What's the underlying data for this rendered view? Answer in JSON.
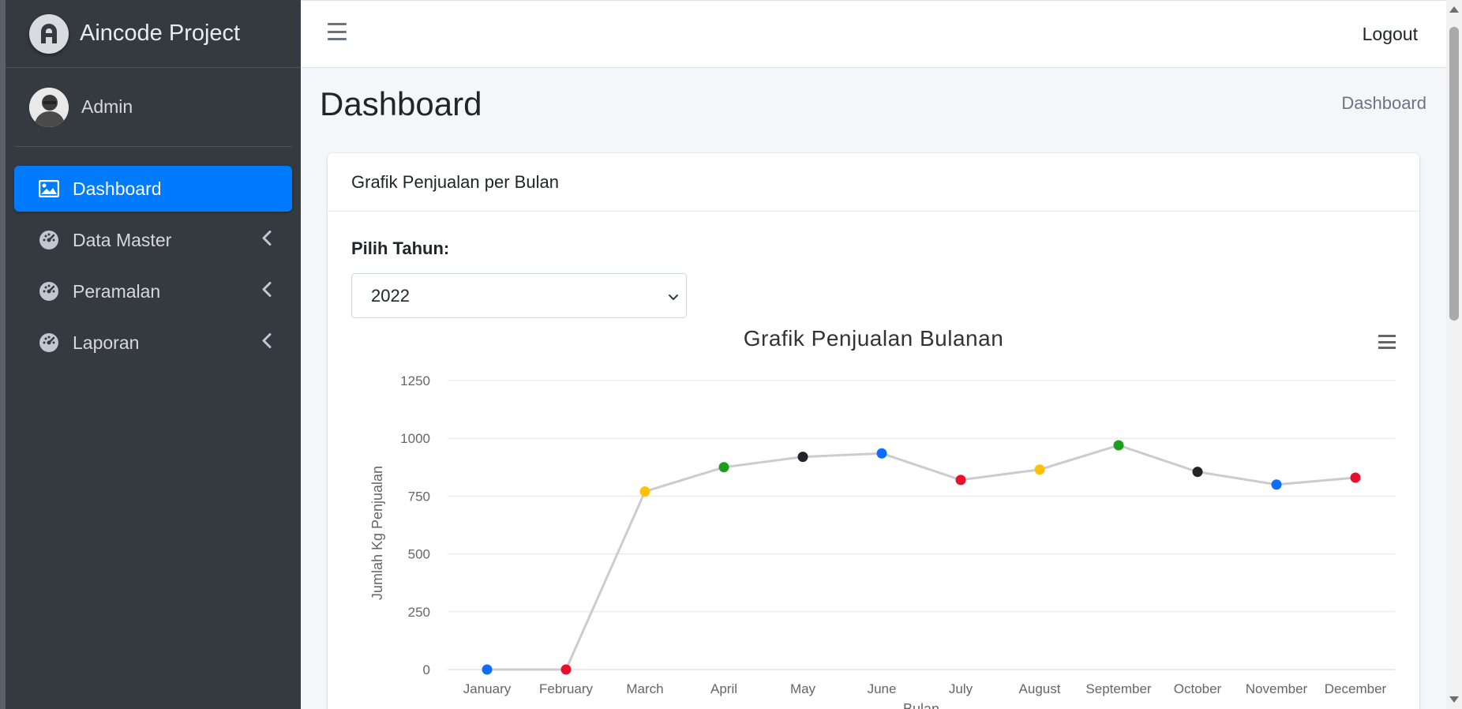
{
  "brand": {
    "name": "Aincode Project"
  },
  "user": {
    "name": "Admin"
  },
  "sidebar": {
    "items": [
      {
        "label": "Dashboard",
        "icon": "image-icon",
        "active": true
      },
      {
        "label": "Data Master",
        "icon": "tachometer-icon",
        "active": false
      },
      {
        "label": "Peramalan",
        "icon": "tachometer-icon",
        "active": false
      },
      {
        "label": "Laporan",
        "icon": "tachometer-icon",
        "active": false
      }
    ]
  },
  "topbar": {
    "logout_label": "Logout"
  },
  "page": {
    "title": "Dashboard",
    "breadcrumb": "Dashboard"
  },
  "card": {
    "header": "Grafik Penjualan per Bulan",
    "year_label": "Pilih Tahun:",
    "year_selected": "2022"
  },
  "colors": {
    "accent": "#007bff",
    "sidebar": "#343a40"
  },
  "chart_data": {
    "type": "line",
    "title": "Grafik Penjualan Bulanan",
    "xlabel": "Bulan",
    "ylabel": "Jumlah Kg Penjualan",
    "categories": [
      "January",
      "February",
      "March",
      "April",
      "May",
      "June",
      "July",
      "August",
      "September",
      "October",
      "November",
      "December"
    ],
    "series": [
      {
        "values": [
          0,
          0,
          770,
          875,
          920,
          935,
          820,
          865,
          970,
          855,
          800,
          830
        ]
      }
    ],
    "point_colors": [
      "#0d6efd",
      "#e8112d",
      "#ffc107",
      "#1e9e1e",
      "#212529",
      "#0d6efd",
      "#e8112d",
      "#ffc107",
      "#1e9e1e",
      "#212529",
      "#0d6efd",
      "#e8112d"
    ],
    "line_color": "#cccccc",
    "yticks": [
      0,
      250,
      500,
      750,
      1000,
      1250
    ],
    "ylim": [
      0,
      1250
    ],
    "grid": true
  }
}
